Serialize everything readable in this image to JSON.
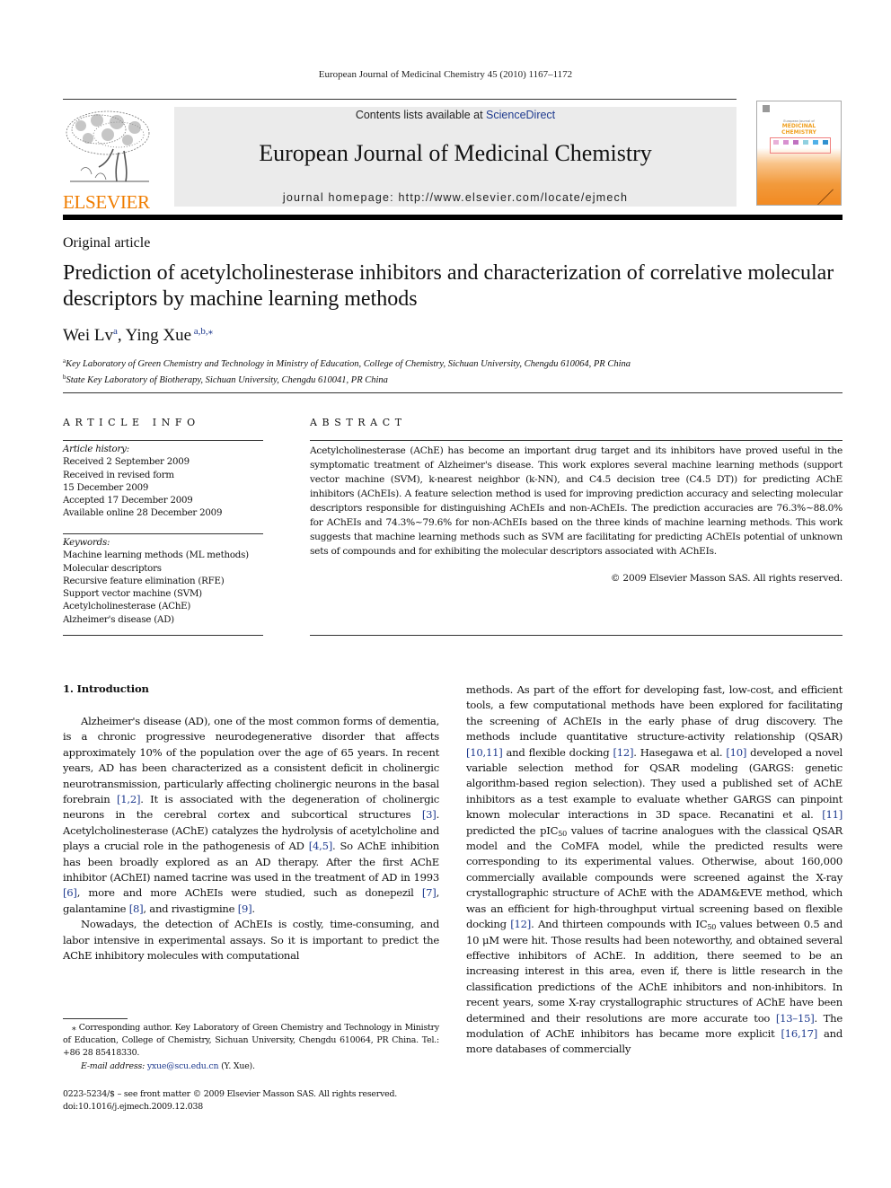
{
  "running_head": "European Journal of Medicinal Chemistry 45 (2010) 1167–1172",
  "publisher": {
    "logo_word": "ELSEVIER",
    "logo_color": "#f07d00"
  },
  "banner": {
    "contents_prefix": "Contents lists available at ",
    "contents_link": "ScienceDirect",
    "journal_title": "European Journal of Medicinal Chemistry",
    "homepage": "journal homepage: http://www.elsevier.com/locate/ejmech"
  },
  "cover": {
    "small_text": "European Journal of",
    "title_line1": "MEDICINAL",
    "title_line2": "CHEMISTRY",
    "strip_colors": [
      "#e8b0d8",
      "#d890d0",
      "#c070c0",
      "#90d0e0",
      "#50b0e8",
      "#3090d0"
    ]
  },
  "article_type": "Original article",
  "title": "Prediction of acetylcholinesterase inhibitors and characterization of correlative molecular descriptors by machine learning methods",
  "authors": [
    {
      "name": "Wei Lv",
      "sup": "a"
    },
    {
      "name": "Ying Xue",
      "sup": "a,b,⁎"
    }
  ],
  "affiliations": [
    {
      "mark": "a",
      "text": "Key Laboratory of Green Chemistry and Technology in Ministry of Education, College of Chemistry, Sichuan University, Chengdu 610064, PR China"
    },
    {
      "mark": "b",
      "text": "State Key Laboratory of Biotherapy, Sichuan University, Chengdu 610041, PR China"
    }
  ],
  "article_info": {
    "heading": "ARTICLE INFO",
    "history_label": "Article history:",
    "history": [
      "Received 2 September 2009",
      "Received in revised form",
      "15 December 2009",
      "Accepted 17 December 2009",
      "Available online 28 December 2009"
    ],
    "keywords_label": "Keywords:",
    "keywords": [
      "Machine learning methods (ML methods)",
      "Molecular descriptors",
      "Recursive feature elimination (RFE)",
      "Support vector machine (SVM)",
      "Acetylcholinesterase (AChE)",
      "Alzheimer's disease (AD)"
    ]
  },
  "abstract": {
    "heading": "ABSTRACT",
    "text": "Acetylcholinesterase (AChE) has become an important drug target and its inhibitors have proved useful in the symptomatic treatment of Alzheimer's disease. This work explores several machine learning methods (support vector machine (SVM), k-nearest neighbor (k-NN), and C4.5 decision tree (C4.5 DT)) for predicting AChE inhibitors (AChEIs). A feature selection method is used for improving prediction accuracy and selecting molecular descriptors responsible for distinguishing AChEIs and non-AChEIs. The prediction accuracies are 76.3%~88.0% for AChEIs and 74.3%~79.6% for non-AChEIs based on the three kinds of machine learning methods. This work suggests that machine learning methods such as SVM are facilitating for predicting AChEIs potential of unknown sets of compounds and for exhibiting the molecular descriptors associated with AChEIs.",
    "copyright": "© 2009 Elsevier Masson SAS. All rights reserved."
  },
  "intro": {
    "heading": "1.  Introduction",
    "left_p1": [
      {
        "t": "Alzheimer's disease (AD), one of the most common forms of dementia, is a chronic progressive neurodegenerative disorder that affects approximately 10% of the population over the age of 65 years. In recent years, AD has been characterized as a consistent deficit in cholinergic neurotransmission, particularly affecting cholinergic neurons in the basal forebrain "
      },
      {
        "ref": "[1,2]"
      },
      {
        "t": ". It is associated with the degeneration of cholinergic neurons in the cerebral cortex and subcortical structures "
      },
      {
        "ref": "[3]"
      },
      {
        "t": ". Acetylcholinesterase (AChE) catalyzes the hydrolysis of acetylcholine and plays a crucial role in the pathogenesis of AD "
      },
      {
        "ref": "[4,5]"
      },
      {
        "t": ". So AChE inhibition has been broadly explored as an AD therapy. After the first AChE inhibitor (AChEI) named tacrine was used in the treatment of AD in 1993 "
      },
      {
        "ref": "[6]"
      },
      {
        "t": ", more and more AChEIs were studied, such as donepezil "
      },
      {
        "ref": "[7]"
      },
      {
        "t": ", galantamine "
      },
      {
        "ref": "[8]"
      },
      {
        "t": ", and rivastigmine "
      },
      {
        "ref": "[9]"
      },
      {
        "t": "."
      }
    ],
    "left_p2": "Nowadays, the detection of AChEIs is costly, time-consuming, and labor intensive in experimental assays. So it is important to predict the AChE inhibitory molecules with computational",
    "right_p1": [
      {
        "t": "methods. As part of the effort for developing fast, low-cost, and efficient tools, a few computational methods have been explored for facilitating the screening of AChEIs in the early phase of drug discovery. The methods include quantitative structure-activity relationship (QSAR) "
      },
      {
        "ref": "[10,11]"
      },
      {
        "t": " and flexible docking "
      },
      {
        "ref": "[12]"
      },
      {
        "t": ". Hasegawa et al. "
      },
      {
        "ref": "[10]"
      },
      {
        "t": " developed a novel variable selection method for QSAR modeling (GARGS: genetic algorithm-based region selection). They used a published set of AChE inhibitors as a test example to evaluate whether GARGS can pinpoint known molecular interactions in 3D space. Recanatini et al. "
      },
      {
        "ref": "[11]"
      },
      {
        "t": " predicted the pIC"
      },
      {
        "sub": "50"
      },
      {
        "t": " values of tacrine analogues with the classical QSAR model and the CoMFA model, while the predicted results were corresponding to its experimental values. Otherwise, about 160,000 commercially available compounds were screened against the X-ray crystallographic structure of AChE with the ADAM&EVE method, which was an efficient for high-throughput virtual screening based on flexible docking "
      },
      {
        "ref": "[12]"
      },
      {
        "t": ". And thirteen compounds with IC"
      },
      {
        "sub": "50"
      },
      {
        "t": " values between 0.5 and 10 μM were hit. Those results had been noteworthy, and obtained several effective inhibitors of AChE. In addition, there seemed to be an increasing interest in this area, even if, there is little research in the classification predictions of the AChE inhibitors and non-inhibitors. In recent years, some X-ray crystallographic structures of AChE have been determined and their resolutions are more accurate too "
      },
      {
        "ref": "[13–15]"
      },
      {
        "t": ". The modulation of AChE inhibitors has became more explicit "
      },
      {
        "ref": "[16,17]"
      },
      {
        "t": " and more databases of commercially"
      }
    ]
  },
  "footnote": {
    "corresponding": "⁎ Corresponding author. Key Laboratory of Green Chemistry and Technology in Ministry of Education, College of Chemistry, Sichuan University, Chengdu 610064, PR China. Tel.: +86 28 85418330.",
    "email_label": "E-mail address: ",
    "email": "yxue@scu.edu.cn",
    "email_suffix": " (Y. Xue)."
  },
  "front_matter": {
    "issn_line": "0223-5234/$ – see front matter © 2009 Elsevier Masson SAS. All rights reserved.",
    "doi": "doi:10.1016/j.ejmech.2009.12.038"
  },
  "colors": {
    "link": "#1f3b8f",
    "banner_bg": "#ebebeb"
  }
}
